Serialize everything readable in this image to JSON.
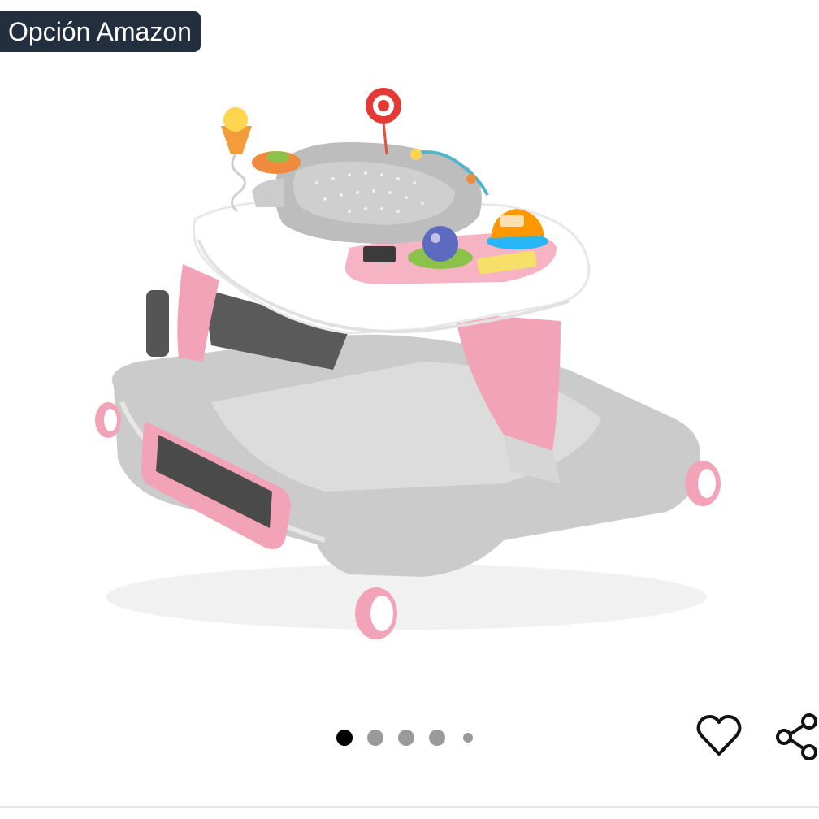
{
  "badge": {
    "label": "Opción Amazon",
    "background": "#232f3e",
    "text_color": "#ffffff"
  },
  "product_image": {
    "subject": "baby-walker",
    "colors": {
      "base_gray": "#c9c9c9",
      "pink": "#f2a3b8",
      "tray_white": "#ffffff",
      "seat_gray": "#bdbdbd"
    }
  },
  "carousel": {
    "current_index": 1,
    "total": 5,
    "active_color": "#000000",
    "inactive_color": "#9a9a9a"
  },
  "actions": {
    "favorite_icon": "heart-outline-icon",
    "share_icon": "share-icon"
  }
}
